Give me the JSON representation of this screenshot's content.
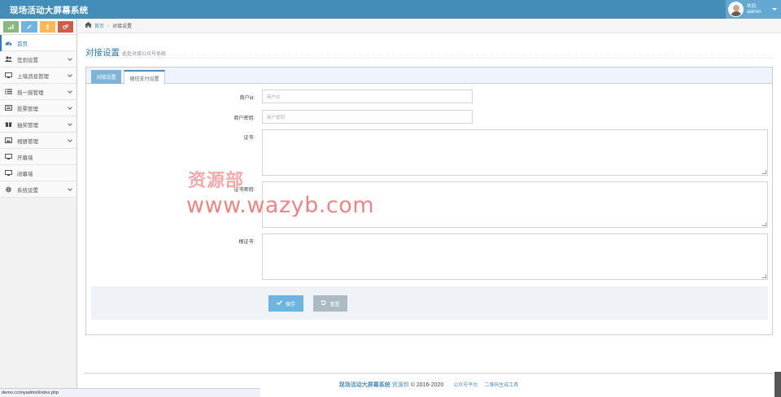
{
  "app": {
    "title": "现场活动大屏幕系统"
  },
  "user": {
    "welcome": "欢迎,",
    "name": "admin"
  },
  "shortcuts": [
    {
      "icon": "signal-icon",
      "color": "#87b87f"
    },
    {
      "icon": "pencil-icon",
      "color": "#6fb3e0"
    },
    {
      "icon": "users-icon",
      "color": "#ffb752"
    },
    {
      "icon": "cogs-icon",
      "color": "#d15b47"
    }
  ],
  "sidebar": {
    "items": [
      {
        "label": "首页",
        "icon": "dashboard-icon",
        "active": true,
        "has_arrow": false
      },
      {
        "label": "签到设置",
        "icon": "users-icon",
        "active": false,
        "has_arrow": true
      },
      {
        "label": "上墙消息管理",
        "icon": "desktop-icon",
        "active": false,
        "has_arrow": true
      },
      {
        "label": "摇一摇管理",
        "icon": "list-icon",
        "active": false,
        "has_arrow": true
      },
      {
        "label": "投票管理",
        "icon": "list-alt-icon",
        "active": false,
        "has_arrow": true
      },
      {
        "label": "抽奖管理",
        "icon": "gift-icon",
        "active": false,
        "has_arrow": true
      },
      {
        "label": "相册管理",
        "icon": "picture-icon",
        "active": false,
        "has_arrow": true
      },
      {
        "label": "开幕墙",
        "icon": "desktop-icon",
        "active": false,
        "has_arrow": false
      },
      {
        "label": "闭幕墙",
        "icon": "desktop-icon",
        "active": false,
        "has_arrow": false
      },
      {
        "label": "系统设置",
        "icon": "gear-icon",
        "active": false,
        "has_arrow": true
      }
    ]
  },
  "breadcrumb": {
    "home": "首页",
    "current": "对接设置"
  },
  "page": {
    "title": "对接设置",
    "subtitle": "此处对接公众号系统"
  },
  "tabs": [
    {
      "label": "对接设置",
      "active": false
    },
    {
      "label": "微信支付设置",
      "active": true
    }
  ],
  "form": {
    "merchant_id": {
      "label": "商户id:",
      "placeholder": "商户ID"
    },
    "merchant_key": {
      "label": "商户密钥:",
      "placeholder": "商户密钥"
    },
    "cert": {
      "label": "证书:"
    },
    "cert_key": {
      "label": "证书密钥:"
    },
    "root_cert": {
      "label": "根证书:"
    }
  },
  "buttons": {
    "save": "保存",
    "reset": "重置"
  },
  "watermark": {
    "line1": "资源部",
    "line2": "www.wazyb.com"
  },
  "footer": {
    "brand": "现场活动大屏幕系统",
    "resource": "资源邦",
    "copyright": "© 2016-2020",
    "link1": "公众号平台",
    "link2": "二维码生成工具"
  },
  "statusbar": {
    "url": "demo.cc/myadmin/index.php"
  },
  "colors": {
    "topbar": "#438eb9",
    "accent": "#2679b5",
    "save": "#6fb3e0",
    "reset": "#abbac3"
  }
}
